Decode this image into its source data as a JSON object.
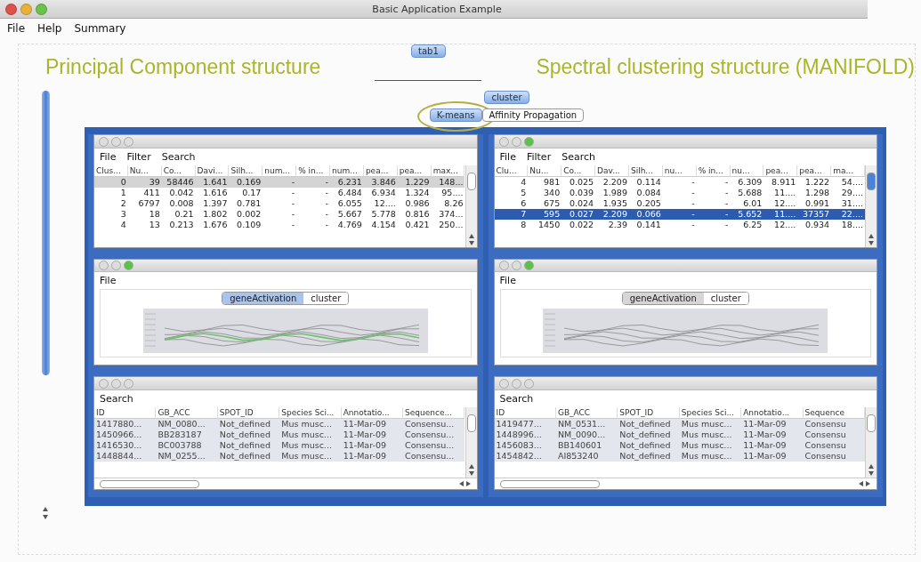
{
  "window": {
    "title": "Basic Application Example"
  },
  "menu": [
    "File",
    "Help",
    "Summary"
  ],
  "annotations": {
    "left_heading": "Principal Component structure",
    "right_heading": "Spectral clustering structure (MANIFOLD)"
  },
  "top_tabs": [
    {
      "label": "tab1",
      "selected": true
    }
  ],
  "view_tabs": [
    {
      "label": "cluster",
      "selected": true
    }
  ],
  "method_tabs": [
    {
      "label": "K-means",
      "selected": true,
      "circled": true
    },
    {
      "label": "Affinity Propagation",
      "selected": false,
      "circled": false
    }
  ],
  "panels": [
    {
      "table_window": {
        "active": false,
        "focused": false,
        "menu": [
          "File",
          "Filter",
          "Search"
        ],
        "columns": [
          "Clus...",
          "Nu...",
          "Co...",
          "Davi...",
          "Silh...",
          "num...",
          "% in...",
          "num...",
          "pea...",
          "pea...",
          "max..."
        ],
        "rows": [
          {
            "selected": true,
            "cells": [
              "0",
              "39",
              "58446",
              "1.641",
              "0.169",
              "-",
              "-",
              "6.231",
              "3.846",
              "1.229",
              "148..."
            ]
          },
          {
            "selected": false,
            "cells": [
              "1",
              "411",
              "0.042",
              "1.616",
              "0.17",
              "-",
              "-",
              "6.484",
              "6.934",
              "1.324",
              "95...."
            ]
          },
          {
            "selected": false,
            "cells": [
              "2",
              "6797",
              "0.008",
              "1.397",
              "0.781",
              "-",
              "-",
              "6.055",
              "12....",
              "0.986",
              "8.26"
            ]
          },
          {
            "selected": false,
            "cells": [
              "3",
              "18",
              "0.21",
              "1.802",
              "0.002",
              "-",
              "-",
              "5.667",
              "5.778",
              "0.816",
              "374..."
            ]
          },
          {
            "selected": false,
            "cells": [
              "4",
              "13",
              "0.213",
              "1.676",
              "0.109",
              "-",
              "-",
              "4.769",
              "4.154",
              "0.421",
              "250..."
            ]
          }
        ]
      },
      "chart_window": {
        "active": true,
        "focused": true,
        "menu": [
          "File"
        ],
        "tabs": [
          {
            "label": "geneActivation",
            "selected": true
          },
          {
            "label": "cluster",
            "selected": false
          }
        ]
      },
      "annotation_window": {
        "active": false,
        "menu": [
          "Search"
        ],
        "columns": [
          "ID",
          "GB_ACC",
          "SPOT_ID",
          "Species Sci...",
          "Annotatio...",
          "Sequence..."
        ],
        "rows": [
          [
            "1417880...",
            "NM_0080...",
            "Not_defined",
            "Mus musc...",
            "11-Mar-09",
            "Consensu..."
          ],
          [
            "1450966...",
            "BB283187",
            "Not_defined",
            "Mus musc...",
            "11-Mar-09",
            "Consensu..."
          ],
          [
            "1416530...",
            "BC003788",
            "Not_defined",
            "Mus musc...",
            "11-Mar-09",
            "Consensu..."
          ],
          [
            "1448844...",
            "NM_0255...",
            "Not_defined",
            "Mus musc...",
            "11-Mar-09",
            "Consensu..."
          ]
        ]
      }
    },
    {
      "table_window": {
        "active": true,
        "focused": true,
        "menu": [
          "File",
          "Filter",
          "Search"
        ],
        "columns": [
          "Clu...",
          "Nu...",
          "Co...",
          "Dav...",
          "Silh...",
          "nu...",
          "% in...",
          "nu...",
          "pea...",
          "pea...",
          "ma..."
        ],
        "rows": [
          {
            "selected": false,
            "cells": [
              "4",
              "981",
              "0.025",
              "2.209",
              "0.114",
              "-",
              "-",
              "6.309",
              "8.911",
              "1.222",
              "54...."
            ]
          },
          {
            "selected": false,
            "cells": [
              "5",
              "340",
              "0.039",
              "1.989",
              "0.084",
              "-",
              "-",
              "5.688",
              "11....",
              "1.298",
              "29...."
            ]
          },
          {
            "selected": false,
            "cells": [
              "6",
              "675",
              "0.024",
              "1.935",
              "0.205",
              "-",
              "-",
              "6.01",
              "12....",
              "0.991",
              "31...."
            ]
          },
          {
            "selected": true,
            "cells": [
              "7",
              "595",
              "0.027",
              "2.209",
              "0.066",
              "-",
              "-",
              "5.652",
              "11....",
              "37357",
              "22...."
            ]
          },
          {
            "selected": false,
            "cells": [
              "8",
              "1450",
              "0.022",
              "2.39",
              "0.141",
              "-",
              "-",
              "6.25",
              "12....",
              "0.934",
              "18...."
            ]
          }
        ]
      },
      "chart_window": {
        "active": true,
        "focused": false,
        "menu": [
          "File"
        ],
        "tabs": [
          {
            "label": "geneActivation",
            "selected": true
          },
          {
            "label": "cluster",
            "selected": false
          }
        ]
      },
      "annotation_window": {
        "active": false,
        "menu": [
          "Search"
        ],
        "columns": [
          "ID",
          "GB_ACC",
          "SPOT_ID",
          "Species Sci...",
          "Annotatio...",
          "Sequence"
        ],
        "rows": [
          [
            "1419477...",
            "NM_0531...",
            "Not_defined",
            "Mus musc...",
            "11-Mar-09",
            "Consensu"
          ],
          [
            "1448996...",
            "NM_0090...",
            "Not_defined",
            "Mus musc...",
            "11-Mar-09",
            "Consensu"
          ],
          [
            "1456083...",
            "BB140601",
            "Not_defined",
            "Mus musc...",
            "11-Mar-09",
            "Consensu"
          ],
          [
            "1454842...",
            "AI853240",
            "Not_defined",
            "Mus musc...",
            "11-Mar-09",
            "Consensu"
          ]
        ]
      }
    }
  ]
}
